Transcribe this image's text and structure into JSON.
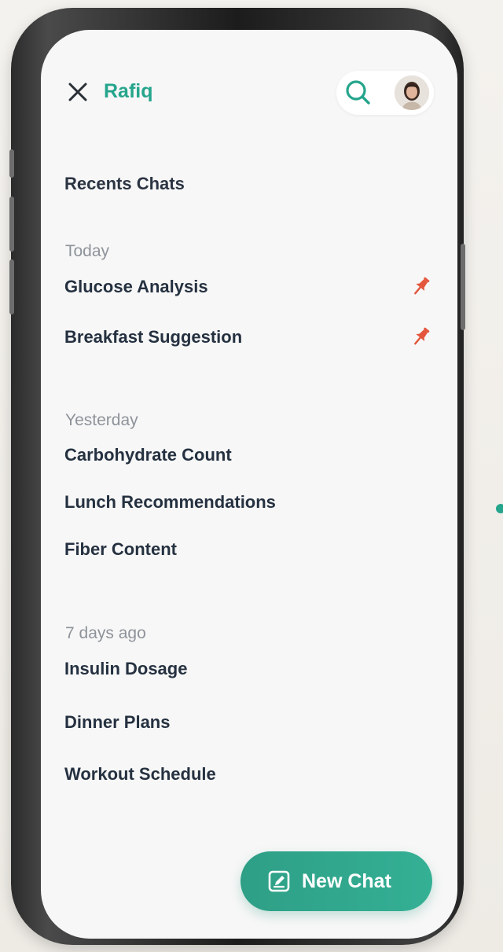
{
  "app": {
    "name": "Rafiq"
  },
  "header": {
    "close_icon": "close-icon",
    "search_icon": "search-icon",
    "avatar": "avatar"
  },
  "recents": {
    "title": "Recents Chats",
    "groups": [
      {
        "label": "Today",
        "items": [
          {
            "label": "Glucose Analysis",
            "pinned": true
          },
          {
            "label": "Breakfast Suggestion",
            "pinned": true
          }
        ]
      },
      {
        "label": "Yesterday",
        "items": [
          {
            "label": "Carbohydrate Count",
            "pinned": false
          },
          {
            "label": "Lunch Recommendations",
            "pinned": false
          },
          {
            "label": "Fiber Content",
            "pinned": false
          }
        ]
      },
      {
        "label": "7 days ago",
        "items": [
          {
            "label": "Insulin Dosage",
            "pinned": false
          },
          {
            "label": "Dinner Plans",
            "pinned": false
          },
          {
            "label": "Workout Schedule",
            "pinned": false
          }
        ]
      }
    ]
  },
  "new_chat": {
    "label": "New Chat",
    "icon": "edit-square-icon"
  },
  "colors": {
    "accent": "#25a58c",
    "pin": "#e3563d",
    "text": "#253140",
    "muted": "#8e939a"
  }
}
